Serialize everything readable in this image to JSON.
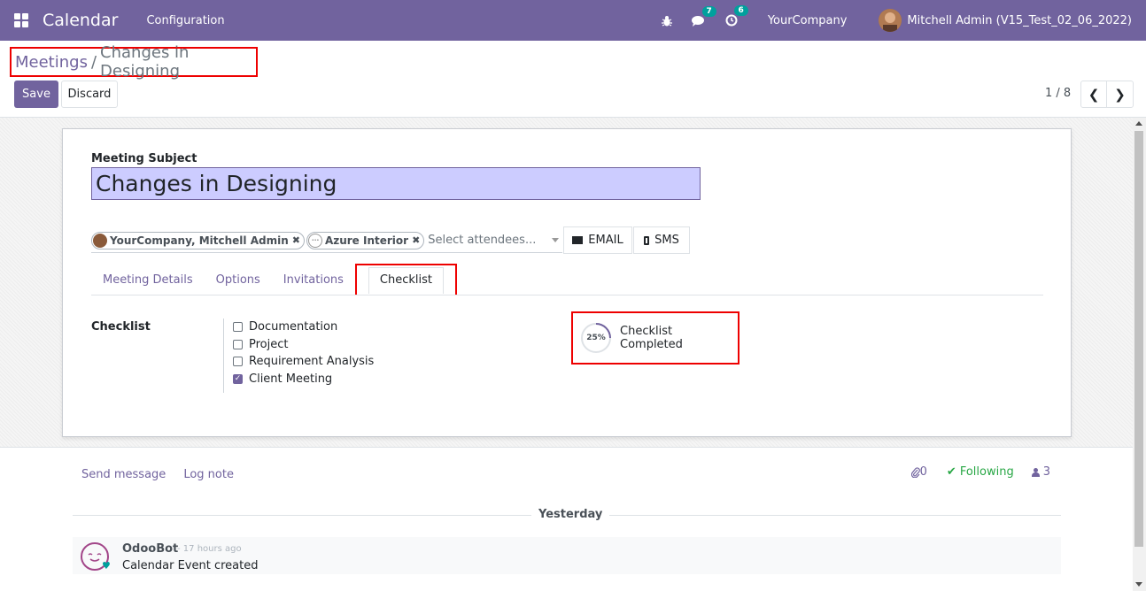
{
  "navbar": {
    "app_title": "Calendar",
    "menu_configuration": "Configuration",
    "messages_count": "7",
    "activities_count": "6",
    "company": "YourCompany",
    "user": "Mitchell Admin (V15_Test_02_06_2022)"
  },
  "breadcrumb": {
    "parent": "Meetings",
    "separator": "/",
    "current": "Changes in Designing"
  },
  "toolbar": {
    "save_label": "Save",
    "discard_label": "Discard"
  },
  "pager": {
    "value": "1 / 8",
    "prev_icon": "chevron-left-icon",
    "next_icon": "chevron-right-icon"
  },
  "form": {
    "subject_label": "Meeting Subject",
    "subject_value": "Changes in Designing",
    "attendees": [
      {
        "name": "YourCompany, Mitchell Admin"
      },
      {
        "name": "Azure Interior"
      }
    ],
    "attendee_placeholder": "Select attendees...",
    "email_label": "EMAIL",
    "sms_label": "SMS",
    "tabs": [
      {
        "label": "Meeting Details",
        "active": false
      },
      {
        "label": "Options",
        "active": false
      },
      {
        "label": "Invitations",
        "active": false
      },
      {
        "label": "Checklist",
        "active": true
      }
    ],
    "checklist_label": "Checklist",
    "checklist_items": [
      {
        "label": "Documentation",
        "checked": false
      },
      {
        "label": "Project",
        "checked": false
      },
      {
        "label": "Requirement Analysis",
        "checked": false
      },
      {
        "label": "Client Meeting",
        "checked": true
      }
    ],
    "progress_percent": 25,
    "progress_label": "25%",
    "progress_text": "Checklist Completed"
  },
  "chatter": {
    "send_message": "Send message",
    "log_note": "Log note",
    "attachments_count": "0",
    "following_label": "Following",
    "followers_count": "3",
    "date_separator": "Yesterday",
    "messages": [
      {
        "author": "OdooBot",
        "time": "- 17 hours ago",
        "body": "Calendar Event created"
      }
    ]
  },
  "colors": {
    "brand": "#71639e",
    "highlight_border": "#ee0000",
    "subject_bg": "#ccccff",
    "follow_green": "#28a745"
  }
}
